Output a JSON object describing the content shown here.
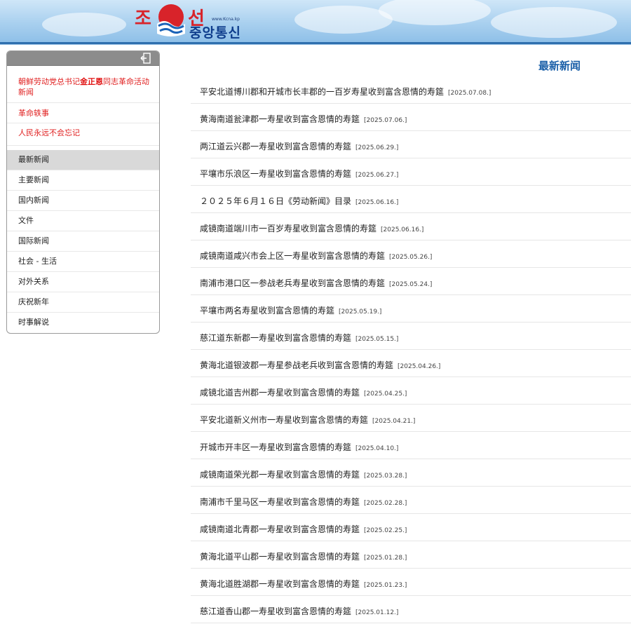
{
  "header": {
    "logo_red_left": "조",
    "logo_red_right": "선",
    "logo_blue": "중앙통신",
    "logo_url": "www.Kcna.kp"
  },
  "sidebar": {
    "special": [
      {
        "prefix": "朝鲜劳动党总书记",
        "highlight": "金正恩",
        "suffix": "同志革命活动新闻"
      },
      {
        "label": "革命轶事"
      },
      {
        "label": "人民永远不会忘记"
      }
    ],
    "categories": [
      {
        "label": "最新新闻",
        "active": true
      },
      {
        "label": "主要新闻",
        "active": false
      },
      {
        "label": "国内新闻",
        "active": false
      },
      {
        "label": "文件",
        "active": false
      },
      {
        "label": "国际新闻",
        "active": false
      },
      {
        "label": "社会 - 生活",
        "active": false
      },
      {
        "label": "对外关系",
        "active": false
      },
      {
        "label": "庆祝新年",
        "active": false
      },
      {
        "label": "时事解说",
        "active": false
      }
    ]
  },
  "main": {
    "title": "最新新闻",
    "news": [
      {
        "title": "平安北道博川郡和开城市长丰郡的一百岁寿星收到富含恩情的寿筵",
        "date": "[2025.07.08.]"
      },
      {
        "title": "黄海南道瓮津郡一寿星收到富含恩情的寿筵",
        "date": "[2025.07.06.]"
      },
      {
        "title": "两江道云兴郡一寿星收到富含恩情的寿筵",
        "date": "[2025.06.29.]"
      },
      {
        "title": "平壤市乐浪区一寿星收到富含恩情的寿筵",
        "date": "[2025.06.27.]"
      },
      {
        "title": "２０２５年６月１６日《劳动新闻》目录",
        "date": "[2025.06.16.]"
      },
      {
        "title": "咸镜南道端川市一百岁寿星收到富含恩情的寿筵",
        "date": "[2025.06.16.]"
      },
      {
        "title": "咸镜南道咸兴市会上区一寿星收到富含恩情的寿筵",
        "date": "[2025.05.26.]"
      },
      {
        "title": "南浦市港口区一参战老兵寿星收到富含恩情的寿筵",
        "date": "[2025.05.24.]"
      },
      {
        "title": "平壤市两名寿星收到富含恩情的寿筵",
        "date": "[2025.05.19.]"
      },
      {
        "title": "慈江道东新郡一寿星收到富含恩情的寿筵",
        "date": "[2025.05.15.]"
      },
      {
        "title": "黄海北道银波郡一寿星参战老兵收到富含恩情的寿筵",
        "date": "[2025.04.26.]"
      },
      {
        "title": "咸镜北道吉州郡一寿星收到富含恩情的寿筵",
        "date": "[2025.04.25.]"
      },
      {
        "title": "平安北道新义州市一寿星收到富含恩情的寿筵",
        "date": "[2025.04.21.]"
      },
      {
        "title": "开城市开丰区一寿星收到富含恩情的寿筵",
        "date": "[2025.04.10.]"
      },
      {
        "title": "咸镜南道荣光郡一寿星收到富含恩情的寿筵",
        "date": "[2025.03.28.]"
      },
      {
        "title": "南浦市千里马区一寿星收到富含恩情的寿筵",
        "date": "[2025.02.28.]"
      },
      {
        "title": "咸镜南道北青郡一寿星收到富含恩情的寿筵",
        "date": "[2025.02.25.]"
      },
      {
        "title": "黄海北道平山郡一寿星收到富含恩情的寿筵",
        "date": "[2025.01.28.]"
      },
      {
        "title": "黄海北道胜湖郡一寿星收到富含恩情的寿筵",
        "date": "[2025.01.23.]"
      },
      {
        "title": "慈江道香山郡一寿星收到富含恩情的寿筵",
        "date": "[2025.01.12.]"
      }
    ]
  },
  "icons": {
    "exit": "exit-icon",
    "emblem": "sun-wave-emblem-icon"
  },
  "colors": {
    "accent_red": "#e02020",
    "title_blue": "#1a5fa8",
    "logo_blue": "#0e3d8c"
  }
}
